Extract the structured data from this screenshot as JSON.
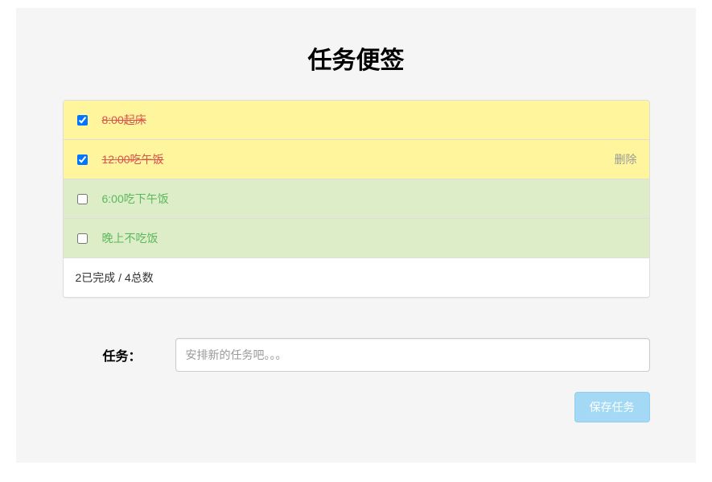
{
  "title": "任务便签",
  "tasks": [
    {
      "text": "8:00起床",
      "done": true,
      "showDelete": false
    },
    {
      "text": "12:00吃午饭",
      "done": true,
      "showDelete": true
    },
    {
      "text": "6:00吃下午饭",
      "done": false,
      "showDelete": false
    },
    {
      "text": "晚上不吃饭",
      "done": false,
      "showDelete": false
    }
  ],
  "deleteLabel": "删除",
  "summary": {
    "completed": 2,
    "completedSuffix": "已完成",
    "separator": " / ",
    "total": 4,
    "totalSuffix": "总数"
  },
  "form": {
    "label": "任务：",
    "placeholder": "安排新的任务吧。。。",
    "value": "",
    "saveLabel": "保存任务"
  }
}
